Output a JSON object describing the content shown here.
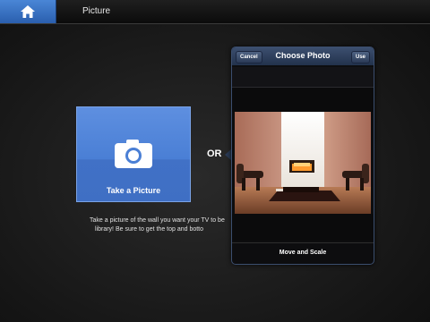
{
  "header": {
    "home_icon": "home-icon",
    "title": "Picture"
  },
  "take_picture": {
    "icon": "camera-icon",
    "label": "Take a Picture"
  },
  "separator": "OR",
  "instructions": {
    "line1": "Take a picture of the wall you want your TV to be",
    "line2": "library! Be sure to get the top and botto"
  },
  "choose_photo": {
    "title": "Choose Photo",
    "cancel_label": "Cancel",
    "use_label": "Use",
    "footer_label": "Move and Scale"
  },
  "colors": {
    "accent_blue": "#4a7fd5",
    "popover_header": "#2c3d5c"
  }
}
